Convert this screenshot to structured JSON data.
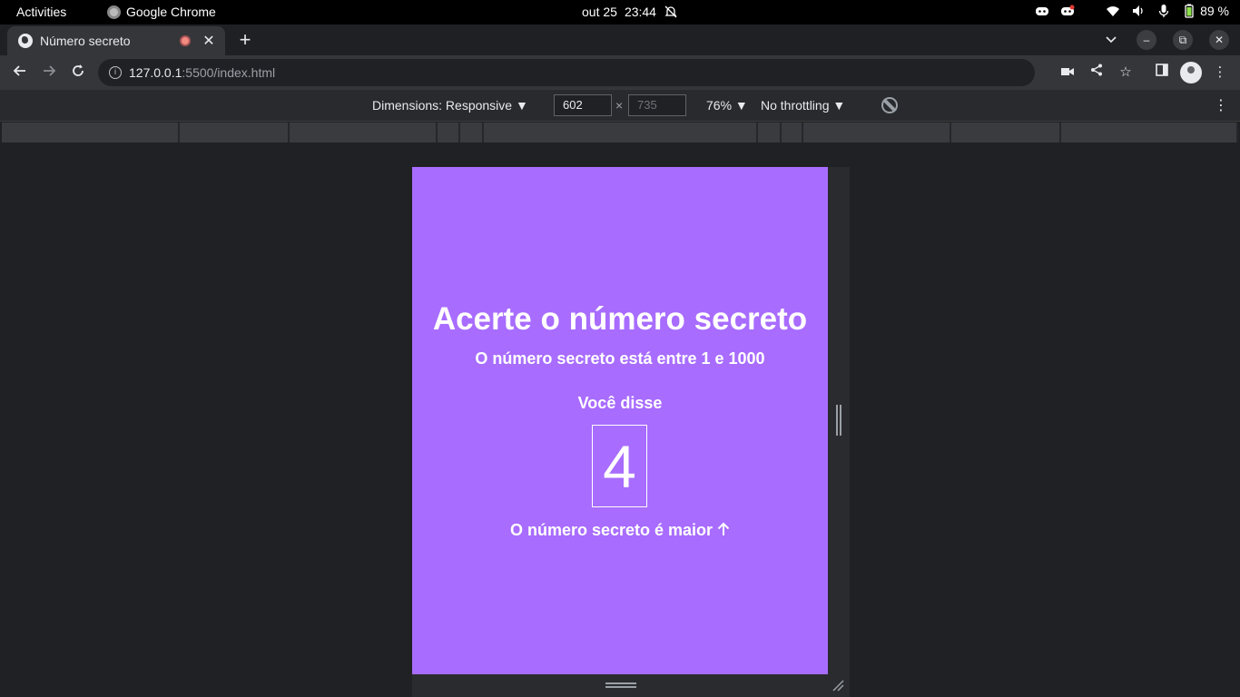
{
  "system": {
    "activities": "Activities",
    "app_name": "Google Chrome",
    "date": "out 25",
    "time": "23:44",
    "battery": "89 %"
  },
  "browser": {
    "tab_title": "Número secreto",
    "url_host": "127.0.0.1",
    "url_path": ":5500/index.html"
  },
  "devtools": {
    "dimensions_label": "Dimensions: Responsive ▼",
    "width": "602",
    "height": "735",
    "times": "×",
    "zoom": "76% ▼",
    "throttling": "No throttling ▼"
  },
  "page": {
    "title": "Acerte o número secreto",
    "subtitle": "O número secreto está entre 1 e 1000",
    "said_label": "Você disse",
    "guess": "4",
    "hint": "O número secreto é maior",
    "hint_arrow": "🡑",
    "background": "#a86cff"
  }
}
